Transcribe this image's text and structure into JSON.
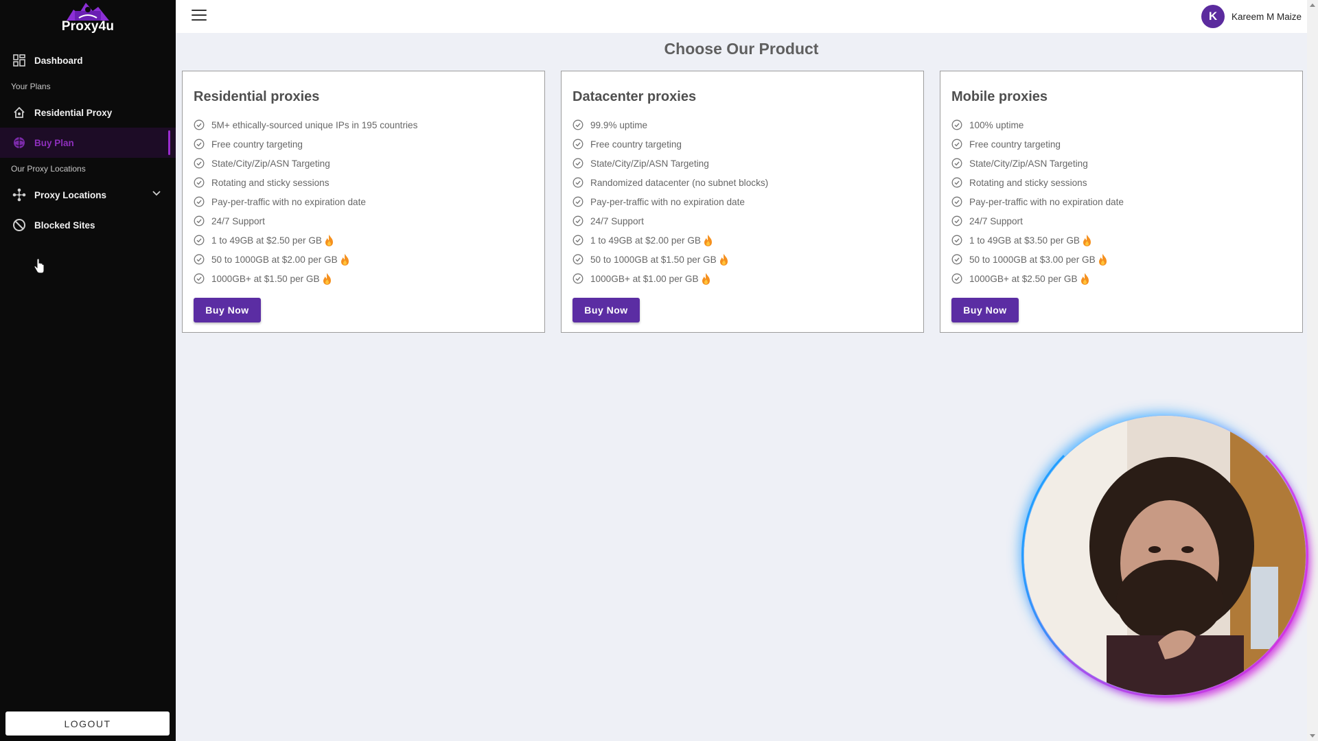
{
  "app": {
    "logo_text": "Proxy4u"
  },
  "sidebar": {
    "dashboard": "Dashboard",
    "section_plans": "Your Plans",
    "residential": "Residential Proxy",
    "buy_plan": "Buy Plan",
    "section_locations": "Our Proxy Locations",
    "proxy_locations": "Proxy Locations",
    "blocked_sites": "Blocked Sites",
    "logout": "LOGOUT"
  },
  "topbar": {
    "user_initial": "K",
    "user_name": "Kareem M Maize"
  },
  "main": {
    "title": "Choose Our Product",
    "cards": [
      {
        "title": "Residential proxies",
        "features": [
          "5M+ ethically-sourced unique IPs in 195 countries",
          "Free country targeting",
          "State/City/Zip/ASN Targeting",
          "Rotating and sticky sessions",
          "Pay-per-traffic with no expiration date",
          "24/7 Support",
          "1 to 49GB at $2.50 per GB",
          "50 to 1000GB at $2.00 per GB",
          "1000GB+ at $1.50 per GB"
        ],
        "button": "Buy Now"
      },
      {
        "title": "Datacenter proxies",
        "features": [
          "99.9% uptime",
          "Free country targeting",
          "State/City/Zip/ASN Targeting",
          "Randomized datacenter (no subnet blocks)",
          "Pay-per-traffic with no expiration date",
          "24/7 Support",
          "1 to 49GB at $2.00 per GB",
          "50 to 1000GB at $1.50 per GB",
          "1000GB+ at $1.00 per GB"
        ],
        "button": "Buy Now"
      },
      {
        "title": "Mobile proxies",
        "features": [
          "100% uptime",
          "Free country targeting",
          "State/City/Zip/ASN Targeting",
          "Rotating and sticky sessions",
          "Pay-per-traffic with no expiration date",
          "24/7 Support",
          "1 to 49GB at $3.50 per GB",
          "50 to 1000GB at $3.00 per GB",
          "1000GB+ at $2.50 per GB"
        ],
        "button": "Buy Now"
      }
    ]
  },
  "icons": {
    "check": "check-circle-icon",
    "price_badge": "fire-icon",
    "menu": "hamburger-icon"
  },
  "colors": {
    "accent": "#5b2da3",
    "sidebar_bg": "#0b0b0b",
    "active_item": "#8e2fbd",
    "page_bg": "#eef0f6"
  }
}
